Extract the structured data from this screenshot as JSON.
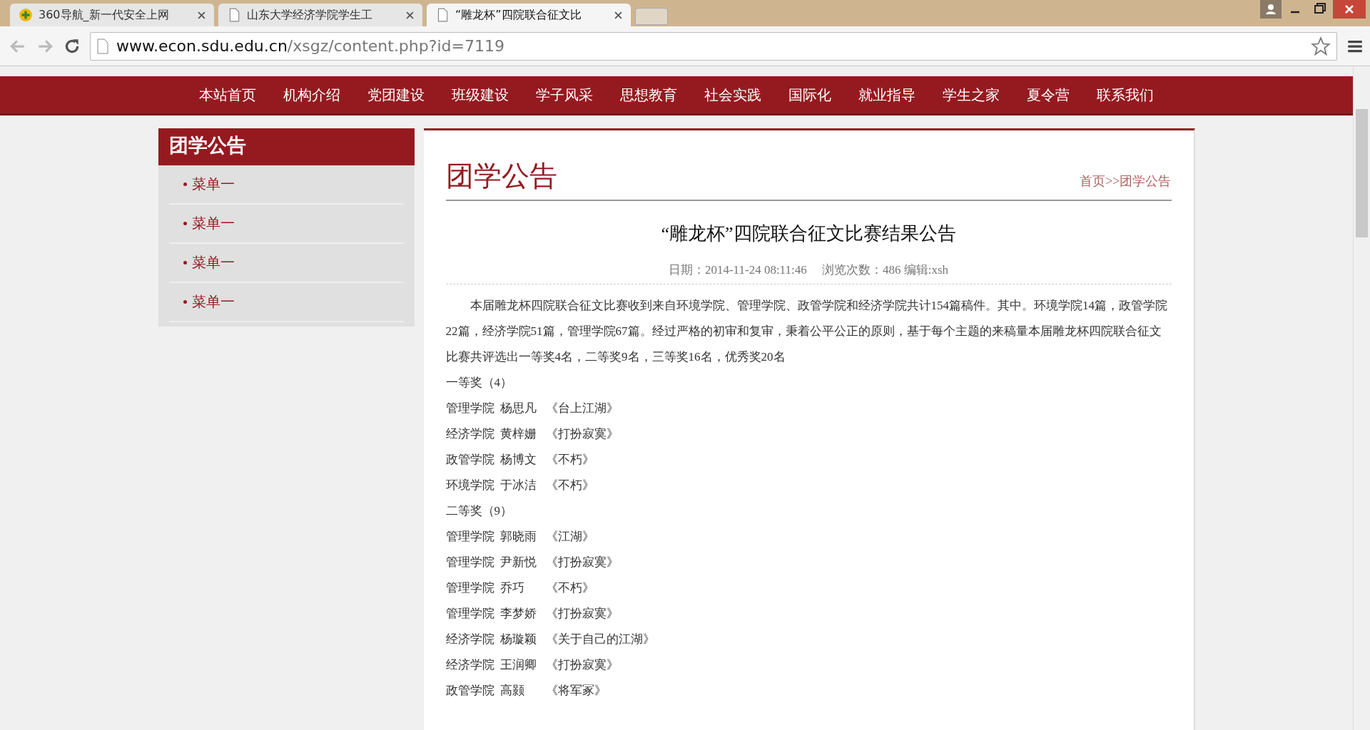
{
  "browser": {
    "tabs": [
      {
        "title": "360导航_新一代安全上网",
        "selected": false,
        "kind": "logo"
      },
      {
        "title": "山东大学经济学院学生工",
        "selected": false,
        "kind": "page"
      },
      {
        "title": "“雕龙杯”四院联合征文比",
        "selected": true,
        "kind": "page"
      }
    ],
    "url": {
      "host": "www.econ.sdu.edu.cn",
      "path": "/xsgz/content.php?id=7119"
    }
  },
  "nav": [
    "本站首页",
    "机构介绍",
    "党团建设",
    "班级建设",
    "学子风采",
    "思想教育",
    "社会实践",
    "国际化",
    "就业指导",
    "学生之家",
    "夏令营",
    "联系我们"
  ],
  "sidebar": {
    "title": "团学公告",
    "items": [
      "菜单一",
      "菜单一",
      "菜单一",
      "菜单一"
    ]
  },
  "content": {
    "section_title": "团学公告",
    "breadcrumb": "首页>>团学公告",
    "article_title": "“雕龙杯”四院联合征文比赛结果公告",
    "meta": "日期：2014-11-24 08:11:46　 浏览次数：486 编辑:xsh",
    "intro": "本届雕龙杯四院联合征文比赛收到来自环境学院、管理学院、政管学院和经济学院共计154篇稿件。其中。环境学院14篇，政管学院22篇，经济学院51篇，管理学院67篇。经过严格的初审和复审，秉着公平公正的原则，基于每个主题的来稿量本届雕龙杯四院联合征文比赛共评选出一等奖4名，二等奖9名，三等奖16名，优秀奖20名",
    "lines": [
      {
        "kind": "heading",
        "text": "一等奖（4）"
      },
      {
        "kind": "entry",
        "college": "管理学院",
        "name": "杨思凡",
        "work": "《台上江湖》"
      },
      {
        "kind": "entry",
        "college": "经济学院",
        "name": "黄梓姗",
        "work": "《打扮寂寞》"
      },
      {
        "kind": "entry",
        "college": "政管学院",
        "name": "杨博文",
        "work": "《不朽》"
      },
      {
        "kind": "entry",
        "college": "环境学院",
        "name": "于冰洁",
        "work": "《不朽》"
      },
      {
        "kind": "heading",
        "text": "二等奖（9）"
      },
      {
        "kind": "entry",
        "college": "管理学院",
        "name": "郭晓雨",
        "work": "《江湖》"
      },
      {
        "kind": "entry",
        "college": "管理学院",
        "name": "尹新悦",
        "work": "《打扮寂寞》"
      },
      {
        "kind": "entry",
        "college": "管理学院",
        "name": "乔巧",
        "work": "《不朽》"
      },
      {
        "kind": "entry",
        "college": "管理学院",
        "name": "李梦娇",
        "work": "《打扮寂寞》"
      },
      {
        "kind": "entry",
        "college": "经济学院",
        "name": "杨璇颖",
        "work": "《关于自己的江湖》"
      },
      {
        "kind": "entry",
        "college": "经济学院",
        "name": "王润卿",
        "work": "《打扮寂寞》"
      },
      {
        "kind": "entry",
        "college": "政管学院",
        "name": "高颢",
        "work": "《将军冢》"
      }
    ]
  }
}
